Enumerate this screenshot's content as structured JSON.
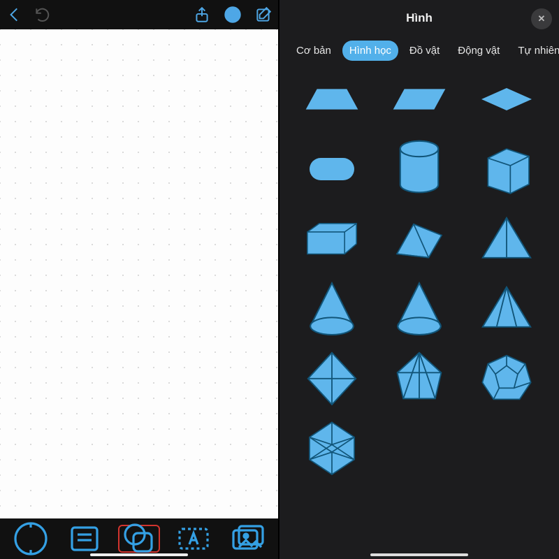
{
  "leftScreen": {
    "topbar": {
      "back": "back-chevron",
      "undo": "undo-icon",
      "share": "share-icon",
      "more": "more-icon",
      "compose": "compose-icon"
    },
    "tools": [
      {
        "name": "pen-tool"
      },
      {
        "name": "note-tool"
      },
      {
        "name": "shapes-tool",
        "highlighted": true
      },
      {
        "name": "text-tool"
      },
      {
        "name": "image-tool"
      }
    ]
  },
  "rightScreen": {
    "title": "Hình",
    "tabs": {
      "items": [
        {
          "label": "Cơ bản"
        },
        {
          "label": "Hình học",
          "active": true
        },
        {
          "label": "Đồ vật"
        },
        {
          "label": "Động vật"
        },
        {
          "label": "Tự nhiên"
        }
      ]
    },
    "shapes": [
      "trapezoid",
      "parallelogram",
      "rhombus-flat",
      "rounded-rect",
      "cylinder",
      "cube",
      "cuboid",
      "prism-triangle",
      "pyramid",
      "cone",
      "cone-open",
      "tetrahedron",
      "octahedron",
      "icosahedron-small",
      "dodecahedron",
      "icosahedron"
    ]
  },
  "colors": {
    "accent": "#4ea7e6",
    "shape": "#5fb6ec",
    "sheet": "#1c1c1e"
  }
}
